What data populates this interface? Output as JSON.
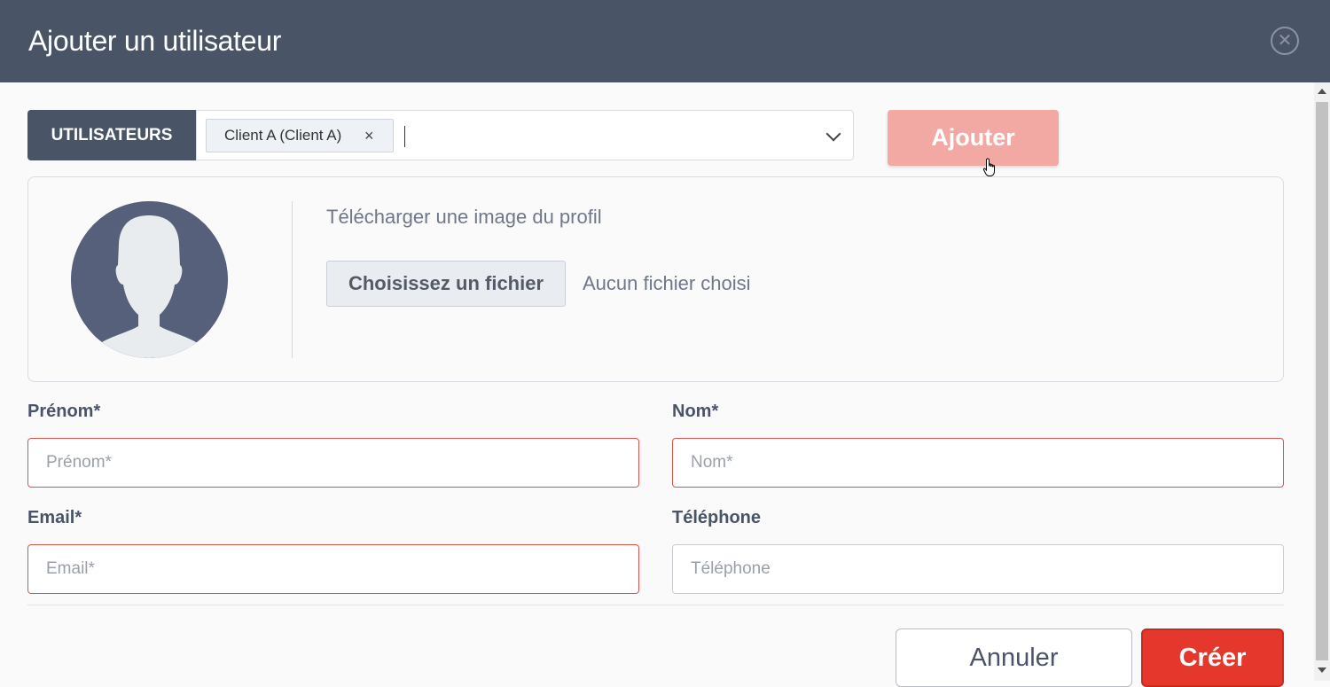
{
  "modal": {
    "title": "Ajouter un utilisateur",
    "close_icon": "close-circle-icon"
  },
  "users": {
    "label": "UTILISATEURS",
    "selected_chip": "Client A (Client A)",
    "chip_remove": "×",
    "add_label": "Ajouter"
  },
  "profile": {
    "upload_label": "Télécharger une image du profil",
    "file_button": "Choisissez un fichier",
    "file_status": "Aucun fichier choisi"
  },
  "form": {
    "firstname": {
      "label": "Prénom*",
      "placeholder": "Prénom*",
      "value": ""
    },
    "lastname": {
      "label": "Nom*",
      "placeholder": "Nom*",
      "value": ""
    },
    "email": {
      "label": "Email*",
      "placeholder": "Email*",
      "value": ""
    },
    "phone": {
      "label": "Téléphone",
      "placeholder": "Téléphone",
      "value": ""
    }
  },
  "footer": {
    "cancel_label": "Annuler",
    "create_label": "Créer"
  },
  "colors": {
    "header": "#4a5467",
    "add_button": "#f2a8a3",
    "create_button": "#e5372b",
    "required_border": "#d9534f"
  }
}
